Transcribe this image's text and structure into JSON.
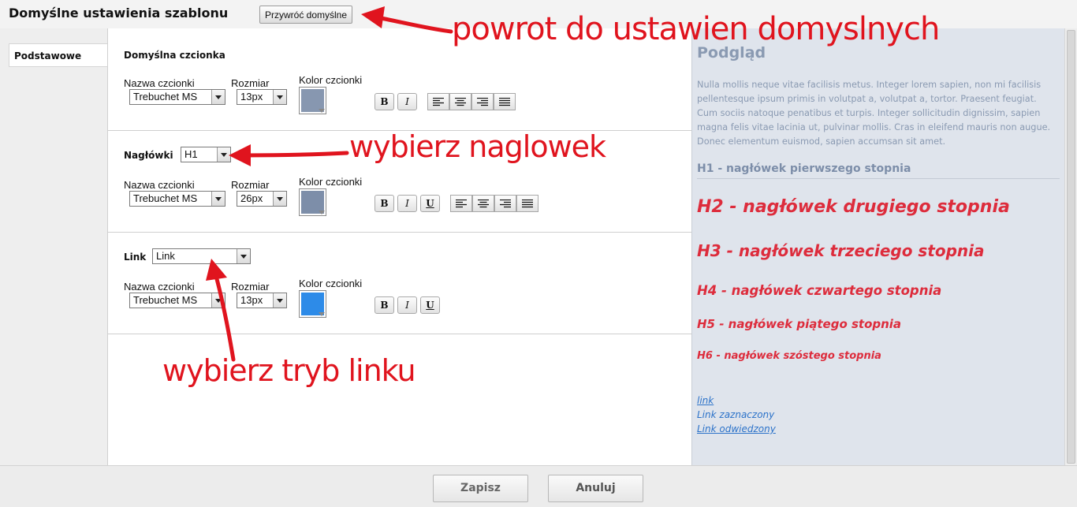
{
  "header": {
    "title": "Domyślne ustawienia szablonu",
    "restore_label": "Przywróć domyślne"
  },
  "tabs": [
    {
      "label": "Podstawowe"
    }
  ],
  "sections": {
    "default_font": {
      "title": "Domyślna czcionka",
      "font_name_label": "Nazwa czcionki",
      "font_name_value": "Trebuchet MS",
      "size_label": "Rozmiar",
      "size_value": "13px",
      "color_label": "Kolor czcionki",
      "color": "#8797b0",
      "bold": "B",
      "italic": "I"
    },
    "headings": {
      "title": "Nagłówki",
      "selected": "H1",
      "font_name_label": "Nazwa czcionki",
      "font_name_value": "Trebuchet MS",
      "size_label": "Rozmiar",
      "size_value": "26px",
      "color_label": "Kolor czcionki",
      "color": "#7d8ea9",
      "bold": "B",
      "italic": "I",
      "underline": "U"
    },
    "link": {
      "title": "Link",
      "selected": "Link",
      "font_name_label": "Nazwa czcionki",
      "font_name_value": "Trebuchet MS",
      "size_label": "Rozmiar",
      "size_value": "13px",
      "color_label": "Kolor czcionki",
      "color": "#2d8be8",
      "bold": "B",
      "italic": "I",
      "underline": "U"
    }
  },
  "preview": {
    "title": "Podgląd",
    "paragraph": "Nulla mollis neque vitae facilisis metus. Integer lorem sapien, non mi facilisis pellentesque ipsum primis in volutpat a, volutpat a, tortor. Praesent feugiat. Cum sociis natoque penatibus et turpis. Integer sollicitudin dignissim, sapien magna felis vitae lacinia ut, pulvinar mollis. Cras in eleifend mauris non augue. Donec elementum euismod, sapien accumsan sit amet.",
    "h1": "H1 - nagłówek pierwszego stopnia",
    "h2": "H2 - nagłówek drugiego stopnia",
    "h3": "H3 - nagłówek trzeciego stopnia",
    "h4": "H4 - nagłówek czwartego stopnia",
    "h5": "H5 - nagłówek piątego stopnia",
    "h6": "H6 - nagłówek szóstego stopnia",
    "link": "link",
    "link_selected": "Link zaznaczony",
    "link_visited": "Link odwiedzony"
  },
  "footer": {
    "save_label": "Zapisz",
    "cancel_label": "Anuluj"
  },
  "annotations": {
    "restore": "powrot do ustawien domyslnych",
    "heading": "wybierz naglowek",
    "link_mode": "wybierz tryb linku"
  },
  "colors": {
    "annotation": "#e0141e",
    "heading_preview": "#dd2c3c",
    "link_preview": "#2b72c9"
  }
}
